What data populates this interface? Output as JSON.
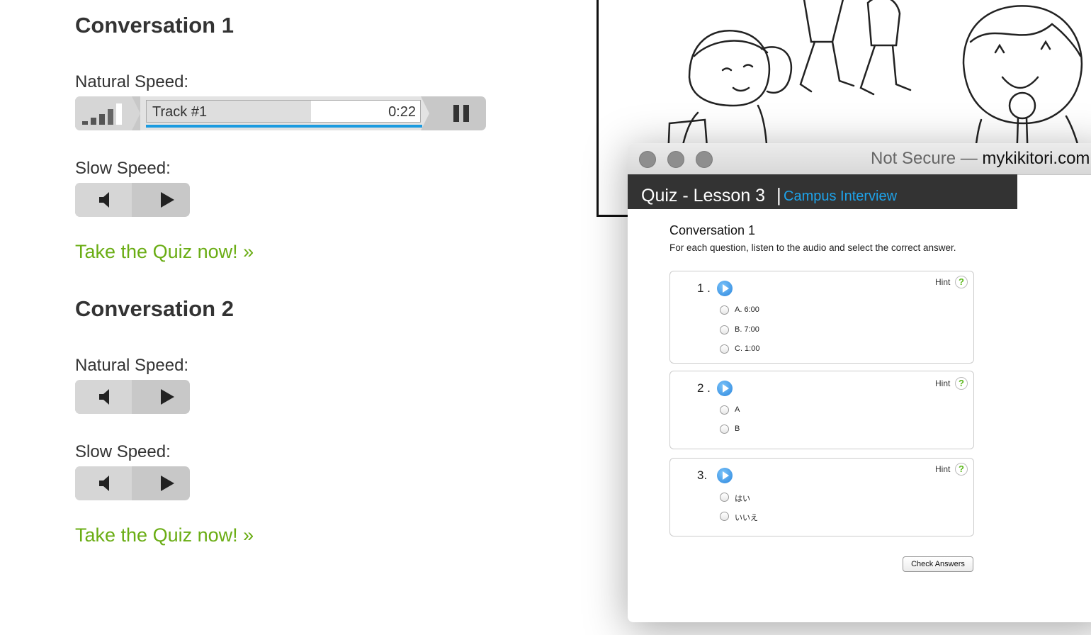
{
  "conversations": [
    {
      "title": "Conversation 1",
      "natural_label": "Natural Speed:",
      "slow_label": "Slow Speed:",
      "quiz_link": "Take the Quiz now! »",
      "player": {
        "track_name": "Track #1",
        "time": "0:22",
        "played_fraction": 0.6,
        "progress_fraction": 1.0
      }
    },
    {
      "title": "Conversation 2",
      "natural_label": "Natural Speed:",
      "slow_label": "Slow Speed:",
      "quiz_link": "Take the Quiz now! »"
    }
  ],
  "browser": {
    "url_prefix": "Not Secure — ",
    "url_domain": "mykikitori.com"
  },
  "quiz": {
    "title": "Quiz - Lesson 3",
    "separator": "|",
    "subtitle": "Campus Interview",
    "heading": "Conversation 1",
    "instructions": "For each question, listen to the audio and select the correct answer.",
    "hint_label": "Hint",
    "hint_symbol": "?",
    "questions": [
      {
        "number": "1 .",
        "options": [
          "A. 6:00",
          "B. 7:00",
          "C. 1:00"
        ]
      },
      {
        "number": "2 .",
        "options": [
          "A",
          "B"
        ]
      },
      {
        "number": "3.",
        "options": [
          "はい",
          "いいえ"
        ]
      }
    ],
    "check_button": "Check Answers"
  },
  "colors": {
    "link_green": "#6aad14",
    "accent_blue": "#1ea3ea",
    "progress_blue": "#1b9be0",
    "header_dark": "#333333"
  },
  "icons": [
    "volume-icon",
    "play-icon",
    "pause-icon",
    "volume-level-icon",
    "audio-play-icon",
    "help-icon"
  ]
}
